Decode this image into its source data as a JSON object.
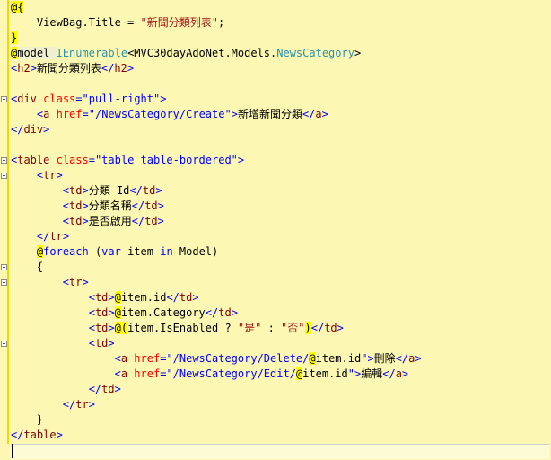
{
  "editor": {
    "lines": [
      [
        {
          "t": "@{",
          "c": "razor"
        }
      ],
      [
        {
          "t": "    ViewBag.Title = ",
          "c": ""
        },
        {
          "t": "\"新聞分類列表\"",
          "c": "str"
        },
        {
          "t": ";",
          "c": ""
        }
      ],
      [
        {
          "t": "}",
          "c": "razor"
        }
      ],
      [
        {
          "t": "@",
          "c": "razor"
        },
        {
          "t": "model ",
          "c": "rzblock"
        },
        {
          "t": "IEnumerable",
          "c": "type"
        },
        {
          "t": "<MVC30dayAdoNet.Models.",
          "c": ""
        },
        {
          "t": "NewsCategory",
          "c": "type"
        },
        {
          "t": ">",
          "c": ""
        }
      ],
      [
        {
          "t": "<",
          "c": "punct"
        },
        {
          "t": "h2",
          "c": "tag"
        },
        {
          "t": ">",
          "c": "punct"
        },
        {
          "t": "新聞分類列表",
          "c": ""
        },
        {
          "t": "</",
          "c": "punct"
        },
        {
          "t": "h2",
          "c": "tag"
        },
        {
          "t": ">",
          "c": "punct"
        }
      ],
      [],
      [
        {
          "t": "<",
          "c": "punct"
        },
        {
          "t": "div",
          "c": "tag"
        },
        {
          "t": " ",
          "c": ""
        },
        {
          "t": "class",
          "c": "attr"
        },
        {
          "t": "=",
          "c": "punct"
        },
        {
          "t": "\"pull-right\"",
          "c": "val"
        },
        {
          "t": ">",
          "c": "punct"
        }
      ],
      [
        {
          "t": "    ",
          "c": ""
        },
        {
          "t": "<",
          "c": "punct"
        },
        {
          "t": "a",
          "c": "tag"
        },
        {
          "t": " ",
          "c": ""
        },
        {
          "t": "href",
          "c": "attr"
        },
        {
          "t": "=",
          "c": "punct"
        },
        {
          "t": "\"/NewsCategory/Create\"",
          "c": "val"
        },
        {
          "t": ">",
          "c": "punct"
        },
        {
          "t": "新增新聞分類",
          "c": ""
        },
        {
          "t": "</",
          "c": "punct"
        },
        {
          "t": "a",
          "c": "tag"
        },
        {
          "t": ">",
          "c": "punct"
        }
      ],
      [
        {
          "t": "</",
          "c": "punct"
        },
        {
          "t": "div",
          "c": "tag"
        },
        {
          "t": ">",
          "c": "punct"
        }
      ],
      [],
      [
        {
          "t": "<",
          "c": "punct"
        },
        {
          "t": "table",
          "c": "tag"
        },
        {
          "t": " ",
          "c": ""
        },
        {
          "t": "class",
          "c": "attr"
        },
        {
          "t": "=",
          "c": "punct"
        },
        {
          "t": "\"table table-bordered\"",
          "c": "val"
        },
        {
          "t": ">",
          "c": "punct"
        }
      ],
      [
        {
          "t": "    ",
          "c": ""
        },
        {
          "t": "<",
          "c": "punct"
        },
        {
          "t": "tr",
          "c": "tag"
        },
        {
          "t": ">",
          "c": "punct"
        }
      ],
      [
        {
          "t": "        ",
          "c": ""
        },
        {
          "t": "<",
          "c": "punct"
        },
        {
          "t": "td",
          "c": "tag"
        },
        {
          "t": ">",
          "c": "punct"
        },
        {
          "t": "分類 Id",
          "c": ""
        },
        {
          "t": "</",
          "c": "punct"
        },
        {
          "t": "td",
          "c": "tag"
        },
        {
          "t": ">",
          "c": "punct"
        }
      ],
      [
        {
          "t": "        ",
          "c": ""
        },
        {
          "t": "<",
          "c": "punct"
        },
        {
          "t": "td",
          "c": "tag"
        },
        {
          "t": ">",
          "c": "punct"
        },
        {
          "t": "分類名稱",
          "c": ""
        },
        {
          "t": "</",
          "c": "punct"
        },
        {
          "t": "td",
          "c": "tag"
        },
        {
          "t": ">",
          "c": "punct"
        }
      ],
      [
        {
          "t": "        ",
          "c": ""
        },
        {
          "t": "<",
          "c": "punct"
        },
        {
          "t": "td",
          "c": "tag"
        },
        {
          "t": ">",
          "c": "punct"
        },
        {
          "t": "是否啟用",
          "c": ""
        },
        {
          "t": "</",
          "c": "punct"
        },
        {
          "t": "td",
          "c": "tag"
        },
        {
          "t": ">",
          "c": "punct"
        }
      ],
      [
        {
          "t": "    ",
          "c": ""
        },
        {
          "t": "</",
          "c": "punct"
        },
        {
          "t": "tr",
          "c": "tag"
        },
        {
          "t": ">",
          "c": "punct"
        }
      ],
      [
        {
          "t": "    ",
          "c": ""
        },
        {
          "t": "@",
          "c": "razor"
        },
        {
          "t": "foreach",
          "c": "kw"
        },
        {
          "t": " (",
          "c": ""
        },
        {
          "t": "var",
          "c": "kw"
        },
        {
          "t": " item ",
          "c": ""
        },
        {
          "t": "in",
          "c": "kw"
        },
        {
          "t": " Model)",
          "c": ""
        }
      ],
      [
        {
          "t": "    {",
          "c": ""
        }
      ],
      [
        {
          "t": "        ",
          "c": ""
        },
        {
          "t": "<",
          "c": "punct"
        },
        {
          "t": "tr",
          "c": "tag"
        },
        {
          "t": ">",
          "c": "punct"
        }
      ],
      [
        {
          "t": "            ",
          "c": ""
        },
        {
          "t": "<",
          "c": "punct"
        },
        {
          "t": "td",
          "c": "tag"
        },
        {
          "t": ">",
          "c": "punct"
        },
        {
          "t": "@",
          "c": "razor"
        },
        {
          "t": "item.id",
          "c": ""
        },
        {
          "t": "</",
          "c": "punct"
        },
        {
          "t": "td",
          "c": "tag"
        },
        {
          "t": ">",
          "c": "punct"
        }
      ],
      [
        {
          "t": "            ",
          "c": ""
        },
        {
          "t": "<",
          "c": "punct"
        },
        {
          "t": "td",
          "c": "tag"
        },
        {
          "t": ">",
          "c": "punct"
        },
        {
          "t": "@",
          "c": "razor"
        },
        {
          "t": "item.Category",
          "c": ""
        },
        {
          "t": "</",
          "c": "punct"
        },
        {
          "t": "td",
          "c": "tag"
        },
        {
          "t": ">",
          "c": "punct"
        }
      ],
      [
        {
          "t": "            ",
          "c": ""
        },
        {
          "t": "<",
          "c": "punct"
        },
        {
          "t": "td",
          "c": "tag"
        },
        {
          "t": ">",
          "c": "punct"
        },
        {
          "t": "@(",
          "c": "razor"
        },
        {
          "t": "item.IsEnabled ? ",
          "c": ""
        },
        {
          "t": "\"是\"",
          "c": "str"
        },
        {
          "t": " : ",
          "c": ""
        },
        {
          "t": "\"否\"",
          "c": "str"
        },
        {
          "t": ")",
          "c": "razor"
        },
        {
          "t": "</",
          "c": "punct"
        },
        {
          "t": "td",
          "c": "tag"
        },
        {
          "t": ">",
          "c": "punct"
        }
      ],
      [
        {
          "t": "            ",
          "c": ""
        },
        {
          "t": "<",
          "c": "punct"
        },
        {
          "t": "td",
          "c": "tag"
        },
        {
          "t": ">",
          "c": "punct"
        }
      ],
      [
        {
          "t": "                ",
          "c": ""
        },
        {
          "t": "<",
          "c": "punct"
        },
        {
          "t": "a",
          "c": "tag"
        },
        {
          "t": " ",
          "c": ""
        },
        {
          "t": "href",
          "c": "attr"
        },
        {
          "t": "=",
          "c": "punct"
        },
        {
          "t": "\"/NewsCategory/Delete/",
          "c": "val"
        },
        {
          "t": "@",
          "c": "razor"
        },
        {
          "t": "item.id",
          "c": ""
        },
        {
          "t": "\"",
          "c": "val"
        },
        {
          "t": ">",
          "c": "punct"
        },
        {
          "t": "刪除",
          "c": ""
        },
        {
          "t": "</",
          "c": "punct"
        },
        {
          "t": "a",
          "c": "tag"
        },
        {
          "t": ">",
          "c": "punct"
        }
      ],
      [
        {
          "t": "                ",
          "c": ""
        },
        {
          "t": "<",
          "c": "punct"
        },
        {
          "t": "a",
          "c": "tag"
        },
        {
          "t": " ",
          "c": ""
        },
        {
          "t": "href",
          "c": "attr"
        },
        {
          "t": "=",
          "c": "punct"
        },
        {
          "t": "\"/NewsCategory/Edit/",
          "c": "val"
        },
        {
          "t": "@",
          "c": "razor"
        },
        {
          "t": "item.id",
          "c": ""
        },
        {
          "t": "\"",
          "c": "val"
        },
        {
          "t": ">",
          "c": "punct"
        },
        {
          "t": "編輯",
          "c": ""
        },
        {
          "t": "</",
          "c": "punct"
        },
        {
          "t": "a",
          "c": "tag"
        },
        {
          "t": ">",
          "c": "punct"
        }
      ],
      [
        {
          "t": "            ",
          "c": ""
        },
        {
          "t": "</",
          "c": "punct"
        },
        {
          "t": "td",
          "c": "tag"
        },
        {
          "t": ">",
          "c": "punct"
        }
      ],
      [
        {
          "t": "        ",
          "c": ""
        },
        {
          "t": "</",
          "c": "punct"
        },
        {
          "t": "tr",
          "c": "tag"
        },
        {
          "t": ">",
          "c": "punct"
        }
      ],
      [
        {
          "t": "    }",
          "c": ""
        }
      ],
      [
        {
          "t": "</",
          "c": "punct"
        },
        {
          "t": "table",
          "c": "tag"
        },
        {
          "t": ">",
          "c": "punct"
        }
      ]
    ],
    "fold_lines": [
      6,
      10,
      11,
      17,
      18,
      22
    ]
  }
}
